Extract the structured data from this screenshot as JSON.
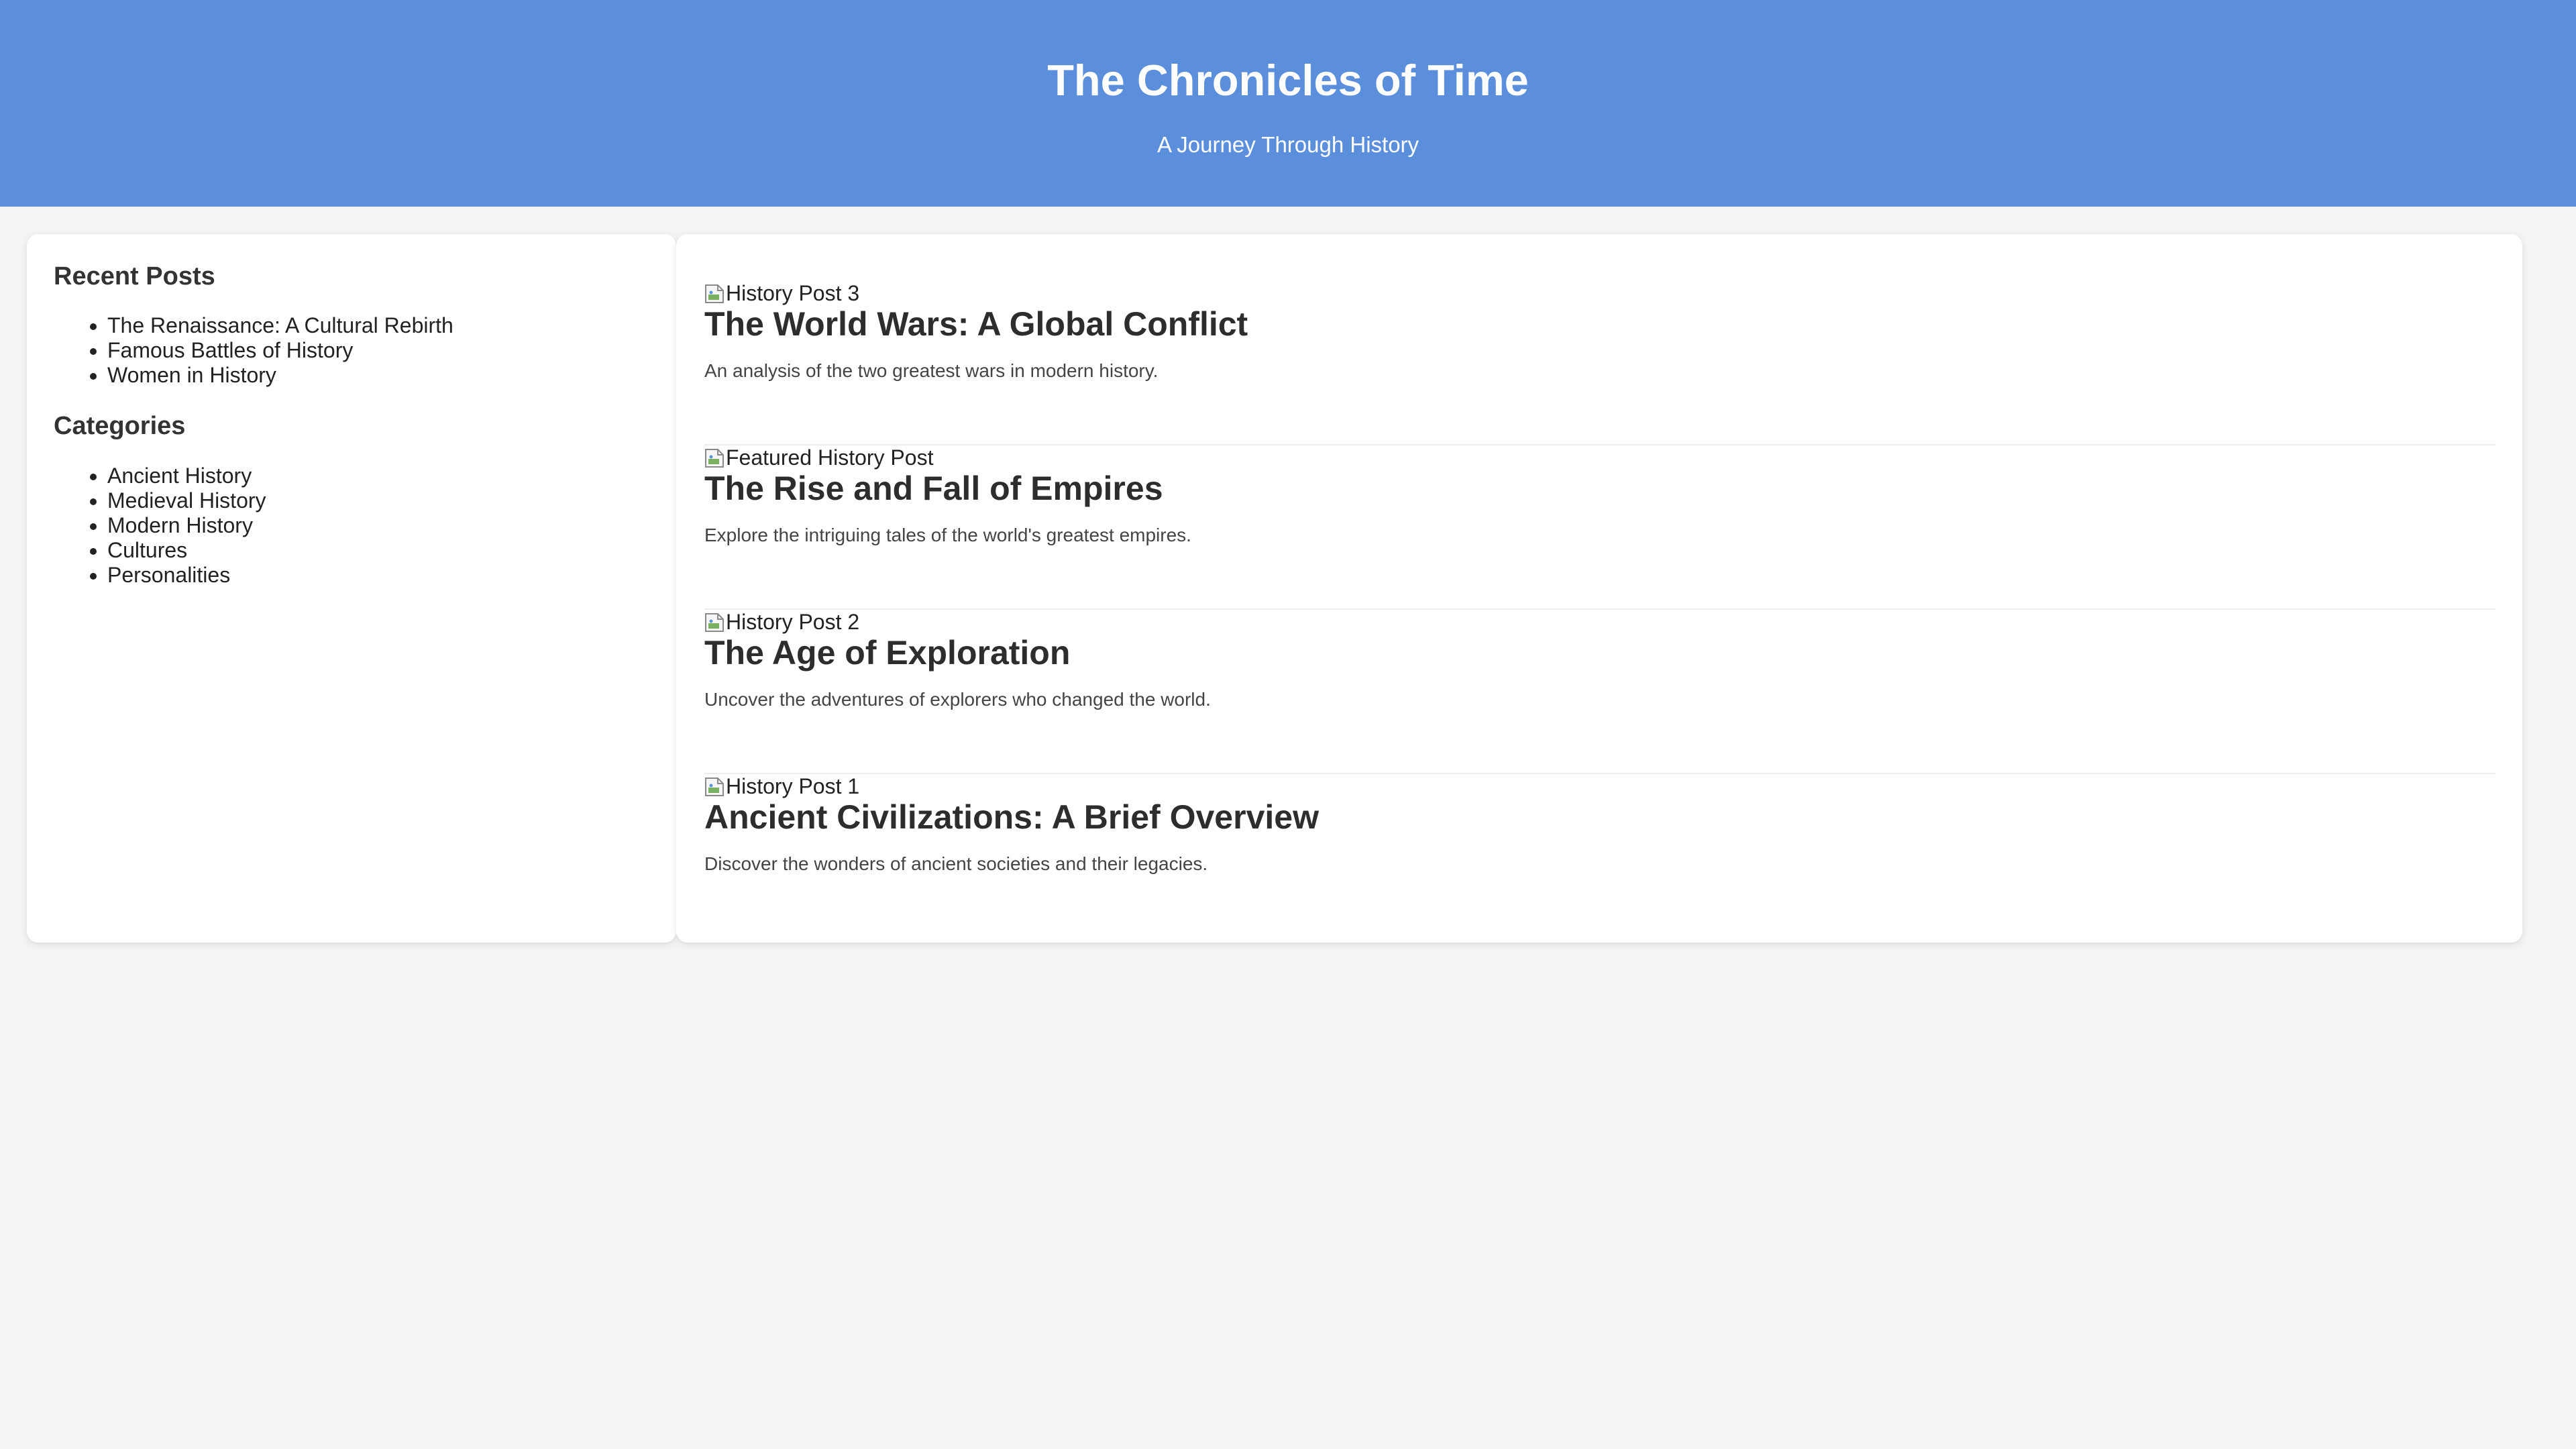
{
  "header": {
    "title": "The Chronicles of Time",
    "tagline": "A Journey Through History"
  },
  "sidebar": {
    "recent_heading": "Recent Posts",
    "recent_posts": [
      "The Renaissance: A Cultural Rebirth",
      "Famous Battles of History",
      "Women in History"
    ],
    "categories_heading": "Categories",
    "categories": [
      "Ancient History",
      "Medieval History",
      "Modern History",
      "Cultures",
      "Personalities"
    ]
  },
  "posts": [
    {
      "image_alt": "History Post 3",
      "title": "The World Wars: A Global Conflict",
      "excerpt": "An analysis of the two greatest wars in modern history."
    },
    {
      "image_alt": "Featured History Post",
      "title": "The Rise and Fall of Empires",
      "excerpt": "Explore the intriguing tales of the world's greatest empires."
    },
    {
      "image_alt": "History Post 2",
      "title": "The Age of Exploration",
      "excerpt": "Uncover the adventures of explorers who changed the world."
    },
    {
      "image_alt": "History Post 1",
      "title": "Ancient Civilizations: A Brief Overview",
      "excerpt": "Discover the wonders of ancient societies and their legacies."
    }
  ],
  "colors": {
    "header_bg": "#5b8fdc",
    "page_bg": "#f4f4f4",
    "card_bg": "#ffffff",
    "text": "#333333"
  },
  "icons": {
    "post_image": "broken-image-icon"
  }
}
